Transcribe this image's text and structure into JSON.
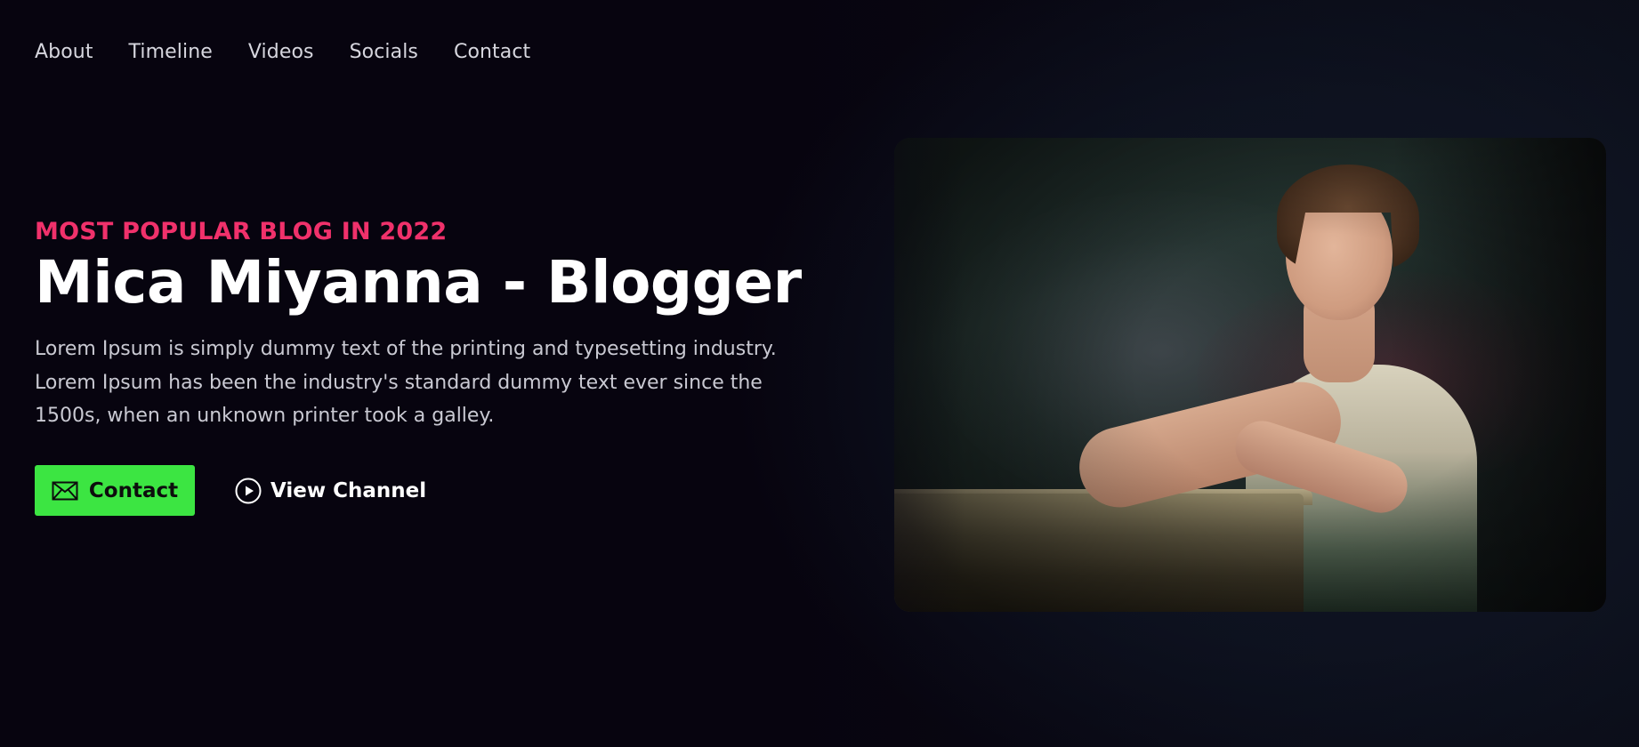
{
  "nav": {
    "items": [
      {
        "label": "About"
      },
      {
        "label": "Timeline"
      },
      {
        "label": "Videos"
      },
      {
        "label": "Socials"
      },
      {
        "label": "Contact"
      }
    ]
  },
  "hero": {
    "eyebrow": "MOST POPULAR BLOG IN 2022",
    "title": "Mica Miyanna - Blogger",
    "description": "Lorem Ipsum is simply dummy text of the printing and typesetting industry. Lorem Ipsum has been the industry's standard dummy text ever since the 1500s, when an unknown printer took a galley.",
    "contact_button": {
      "label": "Contact",
      "icon": "envelope-icon"
    },
    "channel_button": {
      "label": "View Channel",
      "icon": "play-circle-icon"
    }
  },
  "colors": {
    "background": "#07040f",
    "accent_pink": "#f0316b",
    "accent_green": "#3ce542",
    "text": "#ffffff"
  }
}
